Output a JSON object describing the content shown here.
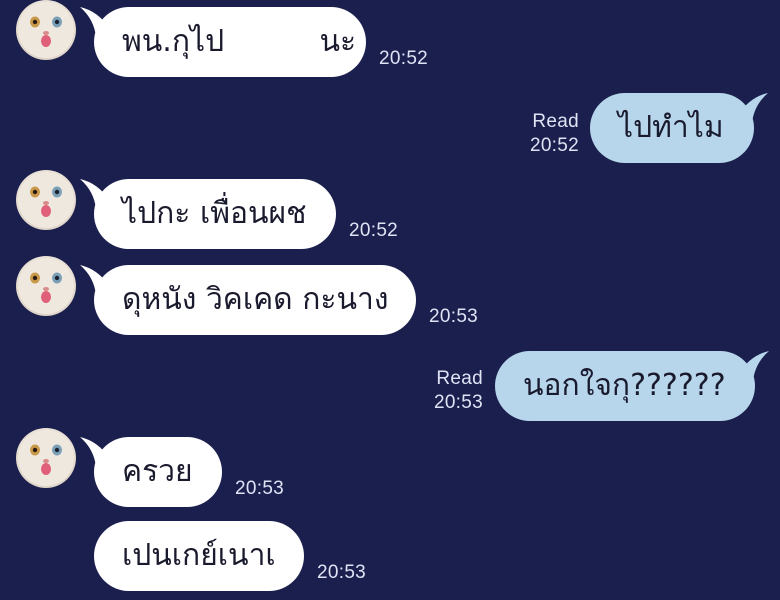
{
  "messages": [
    {
      "dir": "in",
      "text": "พน.กุไป          นะ",
      "time": "20:52"
    },
    {
      "dir": "out",
      "text": "ไปทำไม",
      "time": "20:52",
      "read": "Read"
    },
    {
      "dir": "in",
      "text": "ไปกะ เพื่อนผช",
      "time": "20:52"
    },
    {
      "dir": "in",
      "text": "ดุหนัง วิคเคด กะนาง",
      "time": "20:53"
    },
    {
      "dir": "out",
      "text": "นอกใจกุ??????",
      "time": "20:53",
      "read": "Read"
    },
    {
      "dir": "in",
      "text": "ครวย",
      "time": "20:53"
    },
    {
      "dir": "in",
      "text": "เปนเกย์เนาเ",
      "time": "20:53"
    }
  ],
  "colors": {
    "background": "#1b1f4e",
    "incoming_bubble": "#ffffff",
    "outgoing_bubble": "#b7d6ec",
    "meta_text": "#dfe3f4"
  }
}
